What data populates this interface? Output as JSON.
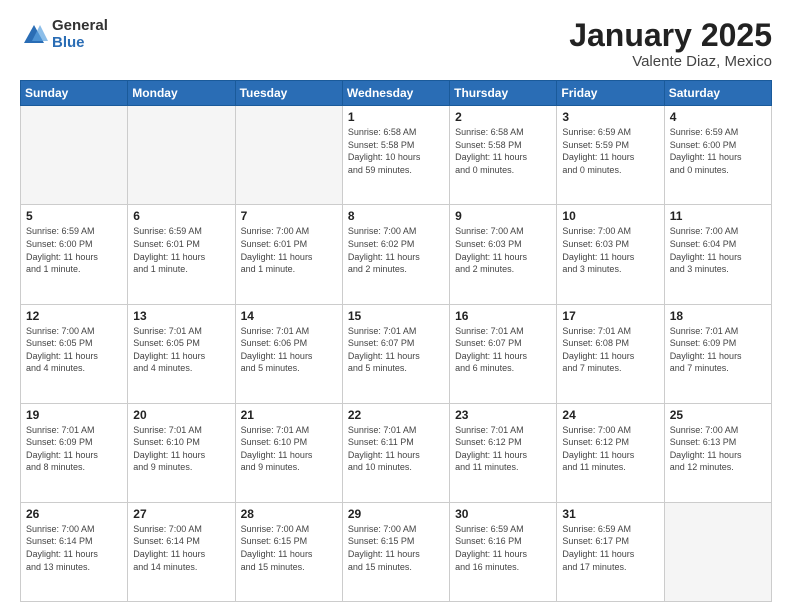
{
  "logo": {
    "general": "General",
    "blue": "Blue"
  },
  "header": {
    "title": "January 2025",
    "subtitle": "Valente Diaz, Mexico"
  },
  "days_header": [
    "Sunday",
    "Monday",
    "Tuesday",
    "Wednesday",
    "Thursday",
    "Friday",
    "Saturday"
  ],
  "weeks": [
    [
      {
        "day": "",
        "info": ""
      },
      {
        "day": "",
        "info": ""
      },
      {
        "day": "",
        "info": ""
      },
      {
        "day": "1",
        "info": "Sunrise: 6:58 AM\nSunset: 5:58 PM\nDaylight: 10 hours\nand 59 minutes."
      },
      {
        "day": "2",
        "info": "Sunrise: 6:58 AM\nSunset: 5:58 PM\nDaylight: 11 hours\nand 0 minutes."
      },
      {
        "day": "3",
        "info": "Sunrise: 6:59 AM\nSunset: 5:59 PM\nDaylight: 11 hours\nand 0 minutes."
      },
      {
        "day": "4",
        "info": "Sunrise: 6:59 AM\nSunset: 6:00 PM\nDaylight: 11 hours\nand 0 minutes."
      }
    ],
    [
      {
        "day": "5",
        "info": "Sunrise: 6:59 AM\nSunset: 6:00 PM\nDaylight: 11 hours\nand 1 minute."
      },
      {
        "day": "6",
        "info": "Sunrise: 6:59 AM\nSunset: 6:01 PM\nDaylight: 11 hours\nand 1 minute."
      },
      {
        "day": "7",
        "info": "Sunrise: 7:00 AM\nSunset: 6:01 PM\nDaylight: 11 hours\nand 1 minute."
      },
      {
        "day": "8",
        "info": "Sunrise: 7:00 AM\nSunset: 6:02 PM\nDaylight: 11 hours\nand 2 minutes."
      },
      {
        "day": "9",
        "info": "Sunrise: 7:00 AM\nSunset: 6:03 PM\nDaylight: 11 hours\nand 2 minutes."
      },
      {
        "day": "10",
        "info": "Sunrise: 7:00 AM\nSunset: 6:03 PM\nDaylight: 11 hours\nand 3 minutes."
      },
      {
        "day": "11",
        "info": "Sunrise: 7:00 AM\nSunset: 6:04 PM\nDaylight: 11 hours\nand 3 minutes."
      }
    ],
    [
      {
        "day": "12",
        "info": "Sunrise: 7:00 AM\nSunset: 6:05 PM\nDaylight: 11 hours\nand 4 minutes."
      },
      {
        "day": "13",
        "info": "Sunrise: 7:01 AM\nSunset: 6:05 PM\nDaylight: 11 hours\nand 4 minutes."
      },
      {
        "day": "14",
        "info": "Sunrise: 7:01 AM\nSunset: 6:06 PM\nDaylight: 11 hours\nand 5 minutes."
      },
      {
        "day": "15",
        "info": "Sunrise: 7:01 AM\nSunset: 6:07 PM\nDaylight: 11 hours\nand 5 minutes."
      },
      {
        "day": "16",
        "info": "Sunrise: 7:01 AM\nSunset: 6:07 PM\nDaylight: 11 hours\nand 6 minutes."
      },
      {
        "day": "17",
        "info": "Sunrise: 7:01 AM\nSunset: 6:08 PM\nDaylight: 11 hours\nand 7 minutes."
      },
      {
        "day": "18",
        "info": "Sunrise: 7:01 AM\nSunset: 6:09 PM\nDaylight: 11 hours\nand 7 minutes."
      }
    ],
    [
      {
        "day": "19",
        "info": "Sunrise: 7:01 AM\nSunset: 6:09 PM\nDaylight: 11 hours\nand 8 minutes."
      },
      {
        "day": "20",
        "info": "Sunrise: 7:01 AM\nSunset: 6:10 PM\nDaylight: 11 hours\nand 9 minutes."
      },
      {
        "day": "21",
        "info": "Sunrise: 7:01 AM\nSunset: 6:10 PM\nDaylight: 11 hours\nand 9 minutes."
      },
      {
        "day": "22",
        "info": "Sunrise: 7:01 AM\nSunset: 6:11 PM\nDaylight: 11 hours\nand 10 minutes."
      },
      {
        "day": "23",
        "info": "Sunrise: 7:01 AM\nSunset: 6:12 PM\nDaylight: 11 hours\nand 11 minutes."
      },
      {
        "day": "24",
        "info": "Sunrise: 7:00 AM\nSunset: 6:12 PM\nDaylight: 11 hours\nand 11 minutes."
      },
      {
        "day": "25",
        "info": "Sunrise: 7:00 AM\nSunset: 6:13 PM\nDaylight: 11 hours\nand 12 minutes."
      }
    ],
    [
      {
        "day": "26",
        "info": "Sunrise: 7:00 AM\nSunset: 6:14 PM\nDaylight: 11 hours\nand 13 minutes."
      },
      {
        "day": "27",
        "info": "Sunrise: 7:00 AM\nSunset: 6:14 PM\nDaylight: 11 hours\nand 14 minutes."
      },
      {
        "day": "28",
        "info": "Sunrise: 7:00 AM\nSunset: 6:15 PM\nDaylight: 11 hours\nand 15 minutes."
      },
      {
        "day": "29",
        "info": "Sunrise: 7:00 AM\nSunset: 6:15 PM\nDaylight: 11 hours\nand 15 minutes."
      },
      {
        "day": "30",
        "info": "Sunrise: 6:59 AM\nSunset: 6:16 PM\nDaylight: 11 hours\nand 16 minutes."
      },
      {
        "day": "31",
        "info": "Sunrise: 6:59 AM\nSunset: 6:17 PM\nDaylight: 11 hours\nand 17 minutes."
      },
      {
        "day": "",
        "info": ""
      }
    ]
  ]
}
